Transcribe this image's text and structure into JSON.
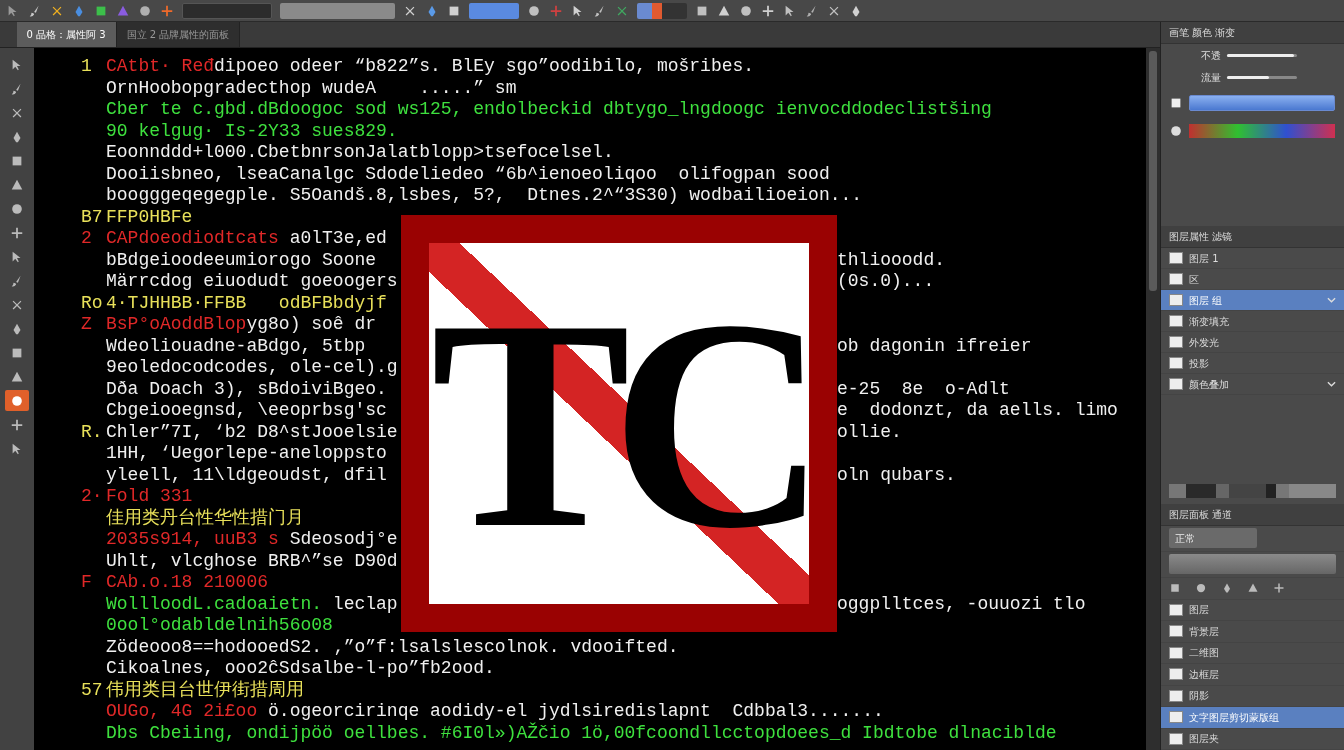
{
  "toolbar": {
    "items": [
      {
        "kind": "icon",
        "color": "#9a9a9a"
      },
      {
        "kind": "icon",
        "color": "#c8c8c8"
      },
      {
        "kind": "icon",
        "color": "#f0b020"
      },
      {
        "kind": "icon",
        "color": "#4a8ee0"
      },
      {
        "kind": "icon",
        "color": "#3cbf4a"
      },
      {
        "kind": "icon",
        "color": "#8a5ce0"
      },
      {
        "kind": "icon",
        "color": "#b0b0b0"
      },
      {
        "kind": "icon",
        "color": "#f06a2a"
      },
      {
        "kind": "field"
      },
      {
        "kind": "field"
      },
      {
        "kind": "icon",
        "color": "#d0d0d0"
      },
      {
        "kind": "icon",
        "color": "#5a9ae8"
      },
      {
        "kind": "icon",
        "color": "#d0d0d0"
      },
      {
        "kind": "group"
      },
      {
        "kind": "icon",
        "color": "#c0c0c0"
      },
      {
        "kind": "icon",
        "color": "#d04040"
      },
      {
        "kind": "icon",
        "color": "#d0d0d0"
      },
      {
        "kind": "icon",
        "color": "#c0c0c0"
      },
      {
        "kind": "icon",
        "color": "#40a860"
      },
      {
        "kind": "swatches"
      },
      {
        "kind": "icon",
        "color": "#c0c0c0"
      },
      {
        "kind": "icon",
        "color": "#d0d0d0"
      },
      {
        "kind": "icon",
        "color": "#c0c0c0"
      },
      {
        "kind": "icon",
        "color": "#d0d0d0"
      },
      {
        "kind": "icon",
        "color": "#c0c0c0"
      },
      {
        "kind": "icon",
        "color": "#b0b0b0"
      },
      {
        "kind": "icon",
        "color": "#c0c0c0"
      },
      {
        "kind": "icon",
        "color": "#d0d0d0"
      }
    ]
  },
  "tabs": [
    {
      "label": "0 品格：属性阿 3",
      "selected": true
    },
    {
      "label": "国立 2 品牌属性的面板",
      "selected": false
    }
  ],
  "tools": [
    {
      "selected": false
    },
    {
      "selected": false
    },
    {
      "selected": false
    },
    {
      "selected": false
    },
    {
      "selected": false
    },
    {
      "selected": false
    },
    {
      "selected": false
    },
    {
      "selected": false
    },
    {
      "selected": false
    },
    {
      "selected": false
    },
    {
      "selected": false
    },
    {
      "selected": false
    },
    {
      "selected": false
    },
    {
      "selected": false
    },
    {
      "selected": true
    },
    {
      "selected": false
    },
    {
      "selected": false
    }
  ],
  "code": {
    "lines": [
      {
        "number": {
          "text": "1",
          "color": "#e8e05a"
        },
        "left": [
          {
            "text": "CAtbt· Ređ",
            "color": "#e02828"
          },
          {
            "text": "dipoeo odeer “b822”s. BlEy sgo”oodibilo, mošribes.",
            "color": "#f0f0f0"
          }
        ]
      },
      {
        "left": [
          {
            "text": "OrnHoobopgradecthop wudeA    .....” sm",
            "color": "#f0f0f0"
          }
        ]
      },
      {
        "left": [
          {
            "text": "Cber te c.gbd.dBdoogoc sod ws125, endolbeckid dbtygo_lngdoogc ienvocddodeclistšing",
            "color": "#3ee03e"
          }
        ]
      },
      {
        "left": [
          {
            "text": "90 kelgug· Is-2Y33 sues829.",
            "color": "#3ee03e"
          }
        ]
      },
      {
        "left": [
          {
            "text": "Eoonnddd+l000.CbetbnrsonJalatblopp>tsefocelsel.",
            "color": "#f0f0f0"
          }
        ]
      },
      {
        "left": [
          {
            "text": "Dooiisbneo, lseaCanalgc Sdodeliedeo “6b^ienoeoliqoo  olifogpan sood",
            "color": "#f0f0f0"
          }
        ]
      },
      {
        "left": [
          {
            "text": "boogggeqegegple. S5Oandš.8,lsbes, 5?,  Dtnes.2^“3S30) wodbailioeion...",
            "color": "#f0f0f0"
          }
        ]
      },
      {
        "number": {
          "text": "B7",
          "color": "#e8e05a"
        },
        "left": [
          {
            "text": "FFP0HBFe",
            "color": "#e8e05a"
          }
        ]
      },
      {
        "number": {
          "text": "2",
          "color": "#e02828"
        },
        "left": [
          {
            "text": "CAPdoeodiodtcats ",
            "color": "#e02828"
          },
          {
            "text": "a0lT3e,ed",
            "color": "#f0f0f0"
          }
        ]
      },
      {
        "left": [
          {
            "text": "bBdgeioodeeumiorogo Soone",
            "color": "#f0f0f0"
          }
        ],
        "right": [
          {
            "text": "thliooodd.",
            "color": "#f0f0f0"
          }
        ]
      },
      {
        "left": [
          {
            "text": "Märrcdog eiuodudt goeoogers",
            "color": "#f0f0f0"
          }
        ],
        "right": [
          {
            "text": "(0s.0)...",
            "color": "#f0f0f0"
          }
        ]
      },
      {
        "number": {
          "text": "Ro",
          "color": "#e8e05a"
        },
        "left": [
          {
            "text": "4·TJHHBB·FFBB   odBFBbdyjf",
            "color": "#e8e05a"
          }
        ]
      },
      {
        "number": {
          "text": "Z",
          "color": "#e02828"
        },
        "left": [
          {
            "text": "BsP°oAoddBlop",
            "color": "#e02828"
          },
          {
            "text": "yg8o) soê dr",
            "color": "#f0f0f0"
          }
        ]
      },
      {
        "left": [
          {
            "text": "Wdeoliouadne-aBdgo, 5tbp",
            "color": "#f0f0f0"
          }
        ],
        "right": [
          {
            "text": "ob dagonin ifreier",
            "color": "#f0f0f0"
          }
        ]
      },
      {
        "left": [
          {
            "text": "9eoledocodcodes, ole-cel).ɡ",
            "color": "#f0f0f0"
          }
        ]
      },
      {
        "left": [
          {
            "text": "Dða Doach 3), sBdoiviBgeo.",
            "color": "#f0f0f0"
          }
        ],
        "right": [
          {
            "text": "e-25  8e  o-Adlt",
            "color": "#f0f0f0"
          }
        ]
      },
      {
        "left": [
          {
            "text": "Cbgeiooegnsd, \\eeoprbsg'sc",
            "color": "#f0f0f0"
          }
        ],
        "right": [
          {
            "text": "e  dodonzt, da aells. limo",
            "color": "#f0f0f0"
          }
        ]
      },
      {
        "number": {
          "text": "R.",
          "color": "#e8e05a"
        },
        "left": [
          {
            "text": "Chler”7I, ‘b2 D8^stJooelsie",
            "color": "#f0f0f0"
          }
        ],
        "right": [
          {
            "text": "ollie.",
            "color": "#f0f0f0"
          }
        ]
      },
      {
        "left": [
          {
            "text": "1HH, ‘Uegorlepe-aneloppsto",
            "color": "#f0f0f0"
          }
        ]
      },
      {
        "left": [
          {
            "text": "yleell, 11\\ldgeoudst, dfil",
            "color": "#f0f0f0"
          }
        ],
        "right": [
          {
            "text": "oln qubars.",
            "color": "#f0f0f0"
          }
        ]
      },
      {
        "number": {
          "text": "2·",
          "color": "#e02828"
        },
        "left": [
          {
            "text": "Fold 331",
            "color": "#e02828"
          }
        ]
      },
      {
        "left": [
          {
            "text": "佳用类丹台性华性措门月",
            "color": "#e8e05a"
          }
        ]
      },
      {
        "left": [
          {
            "text": "2035s914, uuB3 s ",
            "color": "#e02828"
          },
          {
            "text": "Sdeosodj°e",
            "color": "#f0f0f0"
          }
        ]
      },
      {
        "left": [
          {
            "text": "Uhlt, vlcghose BRB^”se D90d",
            "color": "#f0f0f0"
          }
        ]
      },
      {
        "number": {
          "text": "F",
          "color": "#e02828"
        },
        "left": [
          {
            "text": "CAb.o.18 210006",
            "color": "#e02828"
          }
        ]
      },
      {
        "left": [
          {
            "text": "WollloodL.cadoaietn. ",
            "color": "#3ee03e"
          },
          {
            "text": "leclap",
            "color": "#f0f0f0"
          }
        ],
        "right": [
          {
            "text": "oggplltces, -ouuozi tlo",
            "color": "#f0f0f0"
          }
        ]
      },
      {
        "left": [
          {
            "text": "0ool°odabldelnih56o08",
            "color": "#3ee03e"
          }
        ]
      },
      {
        "left": [
          {
            "text": "Zödeooo8==hodooedS2. ‚”o”f:lsalslescolnok. vdooifted.",
            "color": "#f0f0f0"
          }
        ]
      },
      {
        "left": [
          {
            "text": "Cikoalnes, ooo2ĉSdsalbe-l-po”fb2ood.",
            "color": "#f0f0f0"
          }
        ]
      },
      {
        "number": {
          "text": "57",
          "color": "#e8e05a"
        },
        "left": [
          {
            "text": "伟用类目台世伊街措周用",
            "color": "#e8e05a"
          }
        ]
      },
      {
        "left": [
          {
            "text": "OUGo, 4G 2i£oo ",
            "color": "#e02828"
          },
          {
            "text": "ö.ogeorcirinqe aodidy-el jydlsiredislapnt  Cdbbal3.......",
            "color": "#f0f0f0"
          }
        ]
      },
      {
        "left": [
          {
            "text": "Dbs Cbeiing, ondijpöö oellbes. #6I0l»)AŽčio 1ö,00fcoondllcctopdoees_d Ibdtobe dlnaciblde",
            "color": "#3ee03e"
          }
        ]
      }
    ]
  },
  "sign": {
    "text": "TC"
  },
  "brush_panel": {
    "header": "画笔 颜色 渐变",
    "opacity": {
      "label": "不透",
      "level": 0.95
    },
    "flow": {
      "label": "流量",
      "level": 0.6
    }
  },
  "properties": {
    "header": "图层属性 滤镜",
    "items": [
      {
        "label": "图层 1",
        "selected": false
      },
      {
        "label": "区",
        "selected": false
      },
      {
        "label": "图层 组",
        "selected": true,
        "expanded": true
      },
      {
        "label": "渐变填充",
        "selected": false
      },
      {
        "label": "外发光",
        "selected": false
      },
      {
        "label": "投影",
        "selected": false
      },
      {
        "label": "颜色叠加",
        "selected": false,
        "expanded": true
      }
    ]
  },
  "layers": {
    "header": "图层面板 通道",
    "blend": "正常",
    "items": [
      {
        "label": "图层",
        "selected": false
      },
      {
        "label": "背景层",
        "selected": false
      },
      {
        "label": "二维图",
        "selected": false
      },
      {
        "label": "边框层",
        "selected": false
      },
      {
        "label": "阴影",
        "selected": false
      },
      {
        "label": "文字图层剪切蒙版组",
        "selected": true
      },
      {
        "label": "图层夹",
        "selected": false
      }
    ]
  }
}
